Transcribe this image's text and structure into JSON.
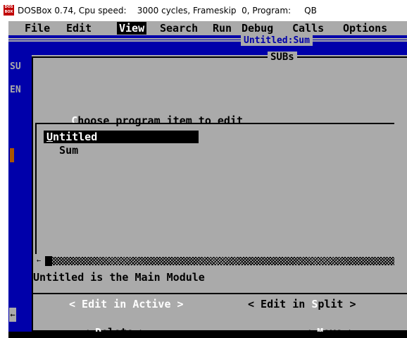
{
  "window": {
    "title": "DOSBox 0.74, Cpu speed:    3000 cycles, Frameskip  0, Program:     QB",
    "icon_text": "DOS BOX"
  },
  "menubar": {
    "items": [
      {
        "label": "File",
        "active": false
      },
      {
        "label": "Edit",
        "active": false
      },
      {
        "label": "View",
        "active": true
      },
      {
        "label": "Search",
        "active": false
      },
      {
        "label": "Run",
        "active": false
      },
      {
        "label": "Debug",
        "active": false
      },
      {
        "label": "Calls",
        "active": false
      },
      {
        "label": "Options",
        "active": false
      }
    ]
  },
  "editor": {
    "title": "Untitled:Sum",
    "line1": "SU",
    "line2": "EN",
    "scroll_arrow": "←"
  },
  "dialog": {
    "title": "SUBs",
    "prompt_hot": "C",
    "prompt_rest": "hoose program item to edit",
    "list_items": [
      {
        "hot": "U",
        "rest": "ntitled",
        "selected": true
      },
      {
        "hot": "",
        "rest": "  Sum",
        "selected": false
      }
    ],
    "hscroll_arrow": "←",
    "status_text": "Untitled is the Main Module",
    "buttons": {
      "edit_active": {
        "pre": "< Edit in ",
        "hot": "A",
        "post": "ctive >"
      },
      "edit_split": {
        "pre": "< Edit in ",
        "hot": "S",
        "post": "plit >"
      },
      "delete": {
        "pre": "< ",
        "hot": "D",
        "post": "elete >"
      },
      "move": {
        "pre": "< ",
        "hot": "M",
        "post": "ove >"
      }
    }
  }
}
